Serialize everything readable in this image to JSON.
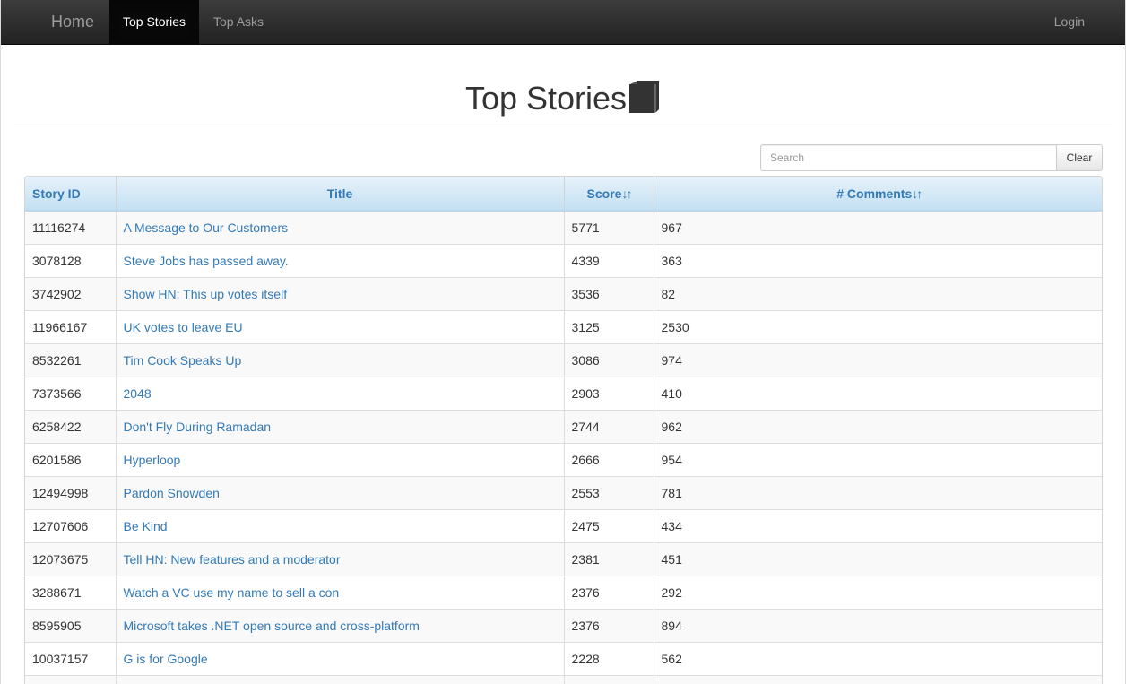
{
  "nav": {
    "brand": "Home",
    "tabs": [
      {
        "label": "Top Stories",
        "active": true
      },
      {
        "label": "Top Asks",
        "active": false
      }
    ],
    "login": "Login"
  },
  "page": {
    "title": "Top Stories",
    "title_icon": "book-icon"
  },
  "search": {
    "placeholder": "Search",
    "value": "",
    "clear_label": "Clear"
  },
  "table": {
    "columns": {
      "id": "Story ID",
      "title": "Title",
      "score": "Score",
      "comments": "# Comments",
      "sort_icon": "sort-icon"
    },
    "rows": [
      {
        "id": "11116274",
        "title": "A Message to Our Customers",
        "score": "5771",
        "comments": "967"
      },
      {
        "id": "3078128",
        "title": "Steve Jobs has passed away.",
        "score": "4339",
        "comments": "363"
      },
      {
        "id": "3742902",
        "title": "Show HN: This up votes itself",
        "score": "3536",
        "comments": "82"
      },
      {
        "id": "11966167",
        "title": "UK votes to leave EU",
        "score": "3125",
        "comments": "2530"
      },
      {
        "id": "8532261",
        "title": "Tim Cook Speaks Up",
        "score": "3086",
        "comments": "974"
      },
      {
        "id": "7373566",
        "title": "2048",
        "score": "2903",
        "comments": "410"
      },
      {
        "id": "6258422",
        "title": "Don't Fly During Ramadan",
        "score": "2744",
        "comments": "962"
      },
      {
        "id": "6201586",
        "title": "Hyperloop",
        "score": "2666",
        "comments": "954"
      },
      {
        "id": "12494998",
        "title": "Pardon Snowden",
        "score": "2553",
        "comments": "781"
      },
      {
        "id": "12707606",
        "title": "Be Kind",
        "score": "2475",
        "comments": "434"
      },
      {
        "id": "12073675",
        "title": "Tell HN: New features and a moderator",
        "score": "2381",
        "comments": "451"
      },
      {
        "id": "3288671",
        "title": "Watch a VC use my name to sell a con",
        "score": "2376",
        "comments": "292"
      },
      {
        "id": "8595905",
        "title": "Microsoft takes .NET open source and cross-platform",
        "score": "2376",
        "comments": "894"
      },
      {
        "id": "10037157",
        "title": "G is for Google",
        "score": "2228",
        "comments": "562"
      },
      {
        "id": "",
        "title": "",
        "score": "",
        "comments": ""
      }
    ]
  },
  "colors": {
    "link": "#337ab7",
    "navbar": "#222222",
    "header_gradient_top": "#e6f2fa",
    "header_gradient_bottom": "#c4e0f2"
  }
}
